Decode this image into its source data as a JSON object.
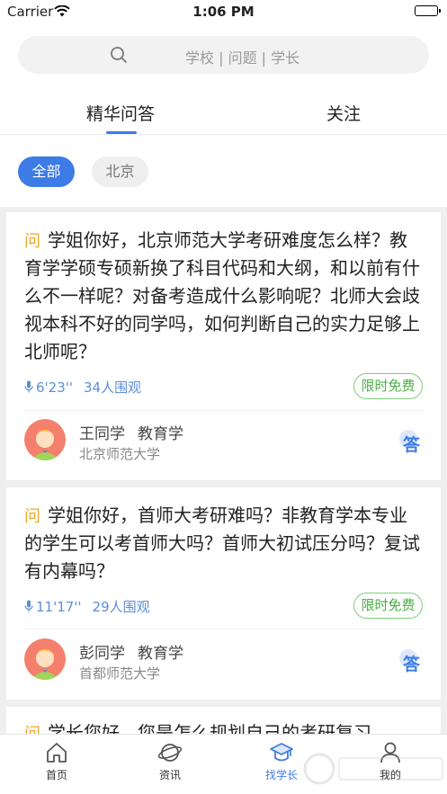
{
  "status_bar": {
    "carrier": "Carrier",
    "time": "1:06 PM"
  },
  "search": {
    "placeholder": "学校 | 问题 | 学长"
  },
  "tabs": [
    {
      "label": "精华问答",
      "active": true
    },
    {
      "label": "关注",
      "active": false
    }
  ],
  "filters": [
    {
      "label": "全部",
      "active": true
    },
    {
      "label": "北京",
      "active": false
    }
  ],
  "questions": [
    {
      "badge": "问",
      "text": "学姐你好，北京师范大学考研难度怎么样？教育学学硕专硕新换了科目代码和大纲，和以前有什么不一样呢？对备考造成什么影响呢？北师大会歧视本科不好的同学吗，如何判断自己的实力足够上北师呢？",
      "duration": "6'23''",
      "views": "34人围观",
      "free_label": "限时免费",
      "user_name": "王同学",
      "major": "教育学",
      "school": "北京师范大学",
      "answer_label": "答"
    },
    {
      "badge": "问",
      "text": "学姐你好，首师大考研难吗？非教育学本专业的学生可以考首师大吗？首师大初试压分吗？复试有内幕吗？",
      "duration": "11'17''",
      "views": "29人围观",
      "free_label": "限时免费",
      "user_name": "彭同学",
      "major": "教育学",
      "school": "首都师范大学",
      "answer_label": "答"
    },
    {
      "badge": "问",
      "text": "学长您好，您是怎么规划自己的考研复习"
    }
  ],
  "tabbar": [
    {
      "label": "首页",
      "icon": "home-icon",
      "active": false
    },
    {
      "label": "资讯",
      "icon": "planet-icon",
      "active": false
    },
    {
      "label": "找学长",
      "icon": "graduation-cap-icon",
      "active": true
    },
    {
      "label": "我的",
      "icon": "person-icon",
      "active": false
    }
  ],
  "colors": {
    "accent": "#3d7be6",
    "free_green": "#4aae45",
    "question_orange": "#f0a72a"
  }
}
